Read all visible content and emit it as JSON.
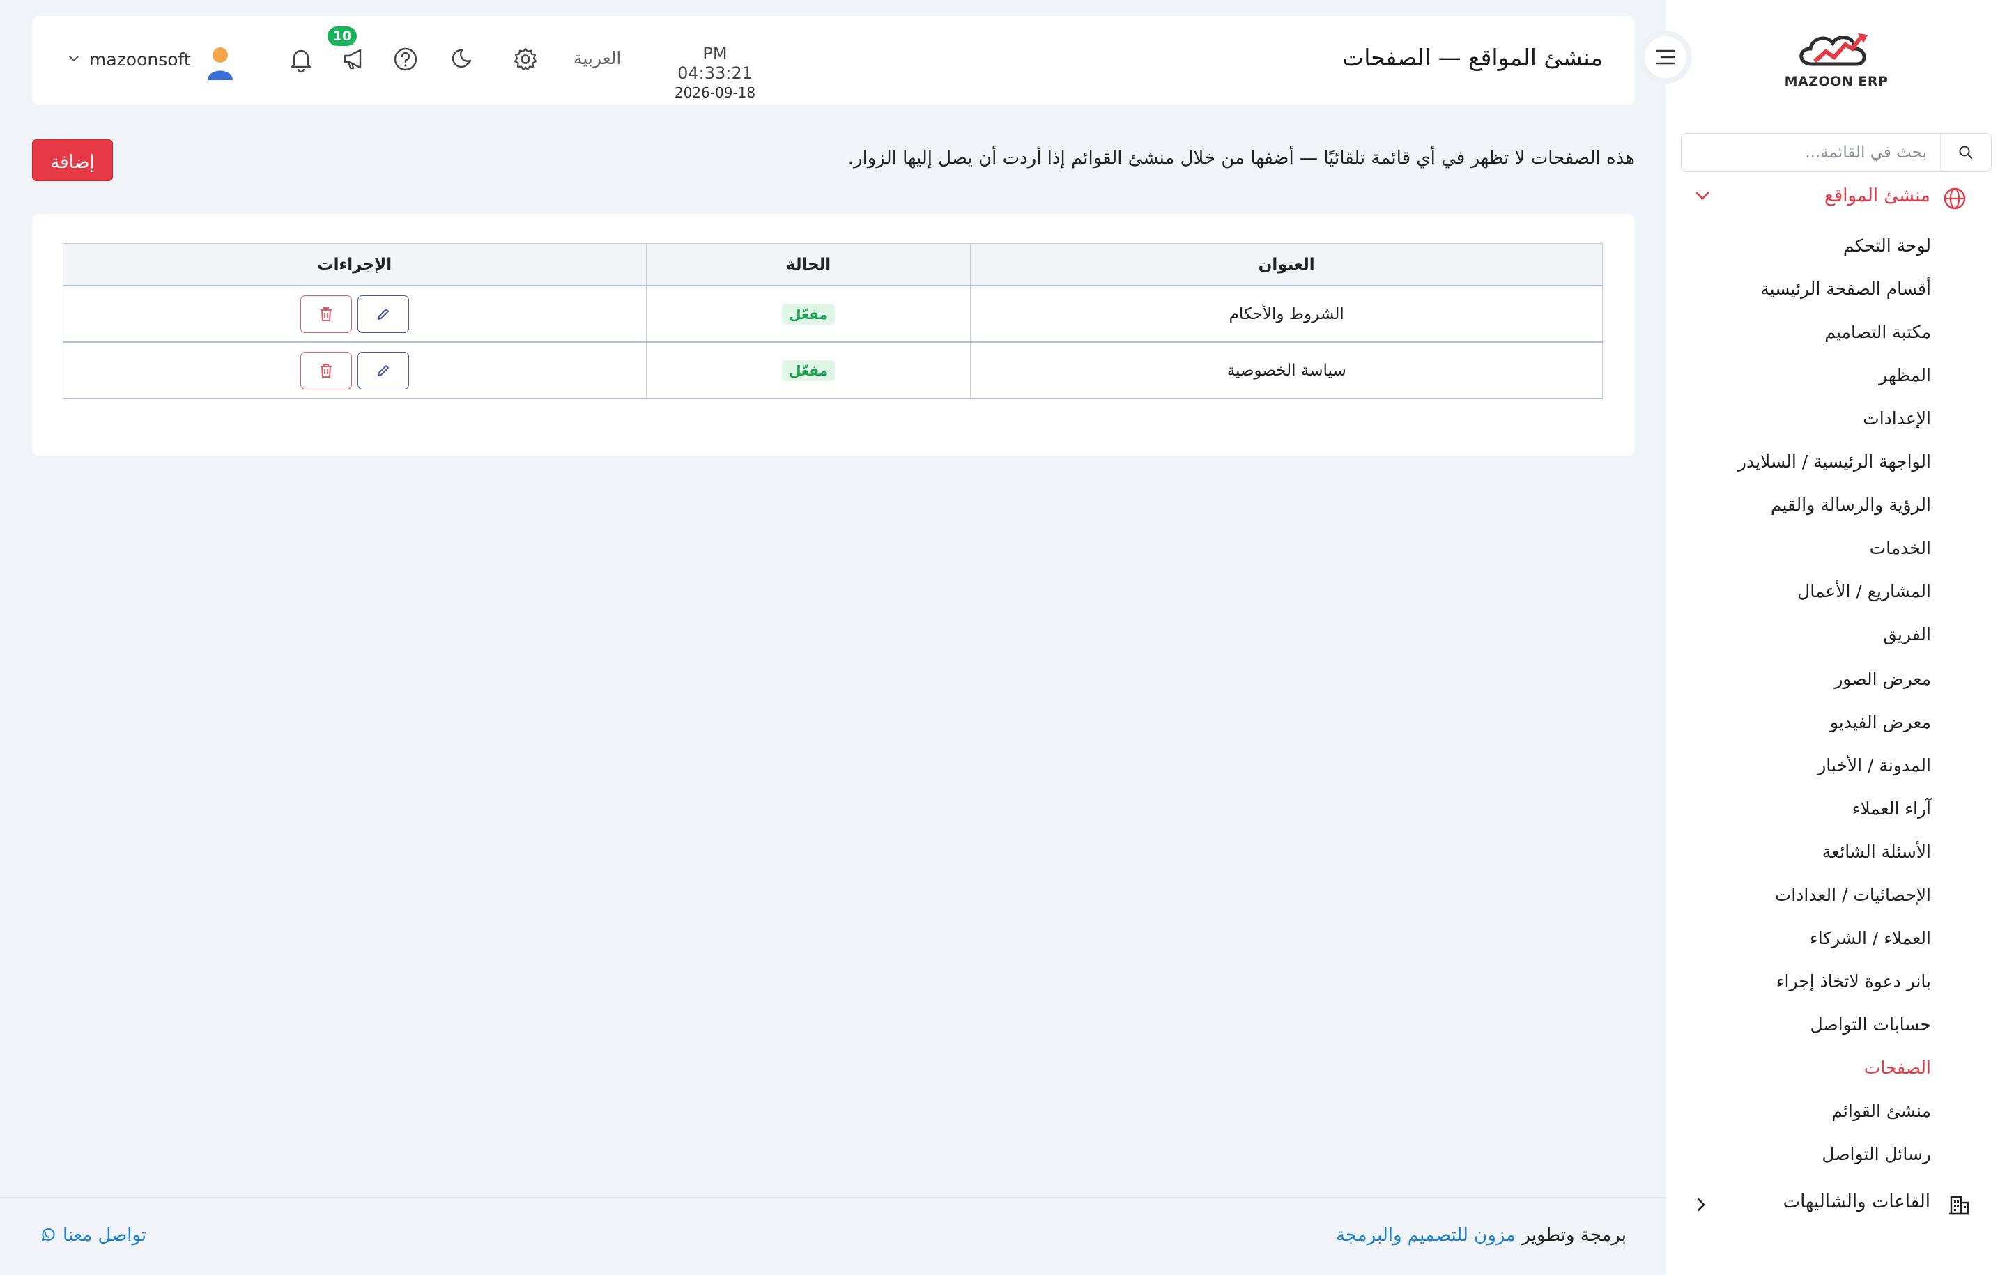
{
  "sidebar": {
    "logo_text": "MAZOON ERP",
    "search_placeholder": "بحث في القائمة...",
    "group": {
      "label": "منشئ المواقع"
    },
    "items": [
      {
        "label": "لوحة التحكم"
      },
      {
        "label": "أقسام الصفحة الرئيسية"
      },
      {
        "label": "مكتبة التصاميم"
      },
      {
        "label": "المظهر"
      },
      {
        "label": "الإعدادات"
      },
      {
        "label": "الواجهة الرئيسية / السلايدر"
      },
      {
        "label": "الرؤية والرسالة والقيم"
      },
      {
        "label": "الخدمات"
      },
      {
        "label": "المشاريع / الأعمال"
      },
      {
        "label": "الفريق"
      },
      {
        "label": "معرض الصور"
      },
      {
        "label": "معرض الفيديو"
      },
      {
        "label": "المدونة / الأخبار"
      },
      {
        "label": "آراء العملاء"
      },
      {
        "label": "الأسئلة الشائعة"
      },
      {
        "label": "الإحصائيات / العدادات"
      },
      {
        "label": "العملاء / الشركاء"
      },
      {
        "label": "بانر دعوة لاتخاذ إجراء"
      },
      {
        "label": "حسابات التواصل"
      },
      {
        "label": "الصفحات",
        "active": true
      },
      {
        "label": "منشئ القوائم"
      },
      {
        "label": "رسائل التواصل"
      }
    ],
    "group2": {
      "label": "القاعات والشاليهات"
    }
  },
  "header": {
    "title": "منشئ المواقع — الصفحات",
    "time": "PM 04:33:21",
    "date": "2026-09-18",
    "language": "العربية",
    "notifications_badge": "10",
    "username": "mazoonsoft"
  },
  "main": {
    "notice": "هذه الصفحات لا تظهر في أي قائمة تلقائيًا — أضفها من خلال منشئ القوائم إذا أردت أن يصل إليها الزوار.",
    "add_button": "إضافة",
    "table": {
      "columns": [
        "العنوان",
        "الحالة",
        "الإجراءات"
      ],
      "rows": [
        {
          "title": "الشروط والأحكام",
          "status": "مفعّل"
        },
        {
          "title": "سياسة الخصوصية",
          "status": "مفعّل"
        }
      ]
    }
  },
  "footer": {
    "credit_prefix": "برمجة وتطوير",
    "credit_brand": "مزون للتصميم والبرمجة",
    "contact": "تواصل معنا"
  },
  "colors": {
    "accent": "#e53946",
    "success": "#19b35b",
    "link": "#1c7fd6",
    "edit": "#4656a8"
  }
}
